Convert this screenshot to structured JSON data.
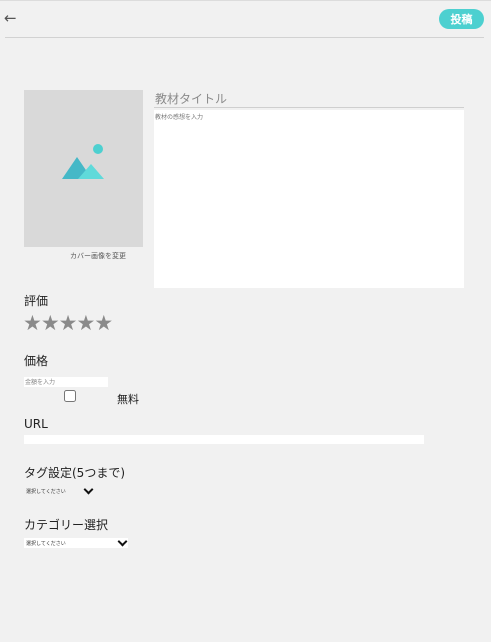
{
  "header": {
    "back_icon": "←",
    "post_label": "投稿",
    "accent_color": "#4dd0d0"
  },
  "cover": {
    "change_label": "カバー画像を変更",
    "placeholder_icon": "image-placeholder-icon"
  },
  "form": {
    "title_placeholder": "教材タイトル",
    "description_placeholder": "教材の感想を入力",
    "rating": {
      "label": "評価",
      "stars": [
        "★",
        "★",
        "★",
        "★",
        "★"
      ],
      "value": 0,
      "max": 5
    },
    "price": {
      "label": "価格",
      "placeholder": "金額を入力",
      "free_label": "無料",
      "free_checked": false
    },
    "url": {
      "label": "URL",
      "value": ""
    },
    "tags": {
      "label": "タグ設定(5つまで)",
      "selected": "選択してください"
    },
    "category": {
      "label": "カテゴリー選択",
      "selected": "選択してください"
    }
  }
}
